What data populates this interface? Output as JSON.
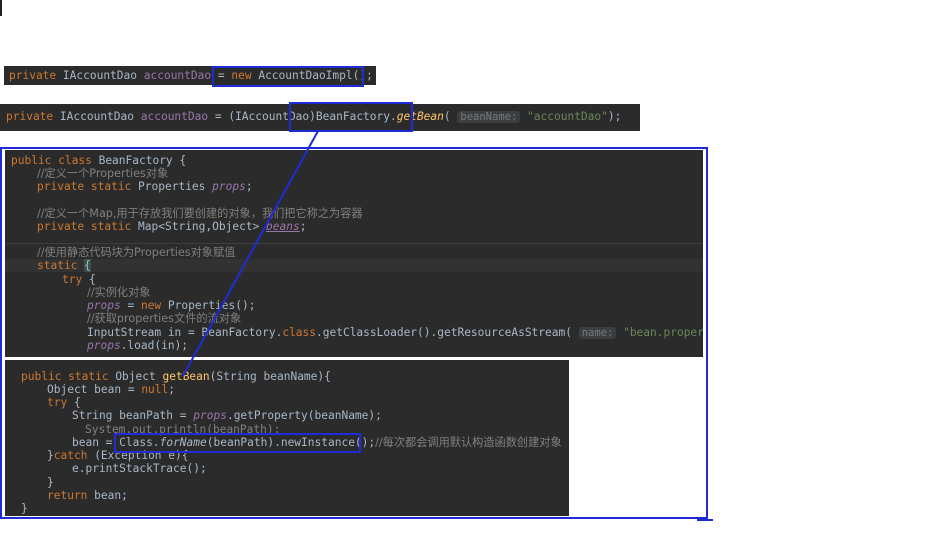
{
  "snippet1": {
    "kw_private": "private",
    "type": "IAccountDao",
    "var": "accountDao",
    "eq": "=",
    "kw_new": "new",
    "ctor": "AccountDaoImpl();"
  },
  "snippet2": {
    "kw_private": "private",
    "type": "IAccountDao",
    "var": "accountDao",
    "cast": "= (IAccountDao)",
    "call_class": "BeanFactory.",
    "call_method": "getBean",
    "paren": "(",
    "hint": "beanName:",
    "arg": "\"accountDao\"",
    "end": ");"
  },
  "factory": {
    "l1_kw": "public class",
    "l1_name": "BeanFactory {",
    "l2_cmt": "//定义一个Properties对象",
    "l3_kw": "private static",
    "l3_type": "Properties",
    "l3_field": "props",
    "l3_end": ";",
    "l5_cmt": "//定义一个Map,用于存放我们要创建的对象，我们把它称之为容器",
    "l6_kw": "private static",
    "l6_type": "Map<String,Object>",
    "l6_field": "beans",
    "l6_end": ";",
    "l8_cmt": "//使用静态代码块为Properties对象赋值",
    "l9_kw": "static",
    "l9_brace": "{",
    "l10_kw": "try",
    "l10_brace": "{",
    "l11_cmt": "//实例化对象",
    "l12_field": "props",
    "l12_eq": "=",
    "l12_kw": "new",
    "l12_rest": "Properties();",
    "l13_cmt": "//获取properties文件的流对象",
    "l14_code": "InputStream in = BeanFactory.",
    "l14_kw": "class",
    "l14_rest": ".getClassLoader().getResourceAsStream(",
    "l14_hint": "name:",
    "l14_str": "\"bean.properties\"",
    "l14_end": ")",
    "l15_field": "props",
    "l15_rest": ".load(in);"
  },
  "getbean": {
    "l1_kw": "public static",
    "l1_type": "Object",
    "l1_method": "getBean",
    "l1_rest": "(String beanName){",
    "l2_code": "Object bean =",
    "l2_kw": "null",
    "l2_end": ";",
    "l3_kw": "try",
    "l3_brace": "{",
    "l4_code": "String beanPath =",
    "l4_field": "props",
    "l4_rest": ".getProperty(beanName);",
    "l5_cmt": "System.out.println(beanPath);",
    "l6_code": "bean =",
    "l6_hl_class": "Class.",
    "l6_hl_method": "forName",
    "l6_hl_rest": "(beanPath).newInstance();",
    "l6_cmt": "//每次都会调用默认构造函数创建对象",
    "l7_code": "}",
    "l7_kw": "catch",
    "l7_rest": "(Exception e){",
    "l8_code": "e.printStackTrace();",
    "l9_code": "}",
    "l10_kw": "return",
    "l10_rest": "bean;",
    "l11_code": "}"
  },
  "colors": {
    "annotation": "#1f2bd6",
    "editor_bg": "#2b2b2b",
    "keyword": "#cc7832",
    "field": "#9876aa",
    "string": "#6a8759",
    "comment": "#808080"
  }
}
